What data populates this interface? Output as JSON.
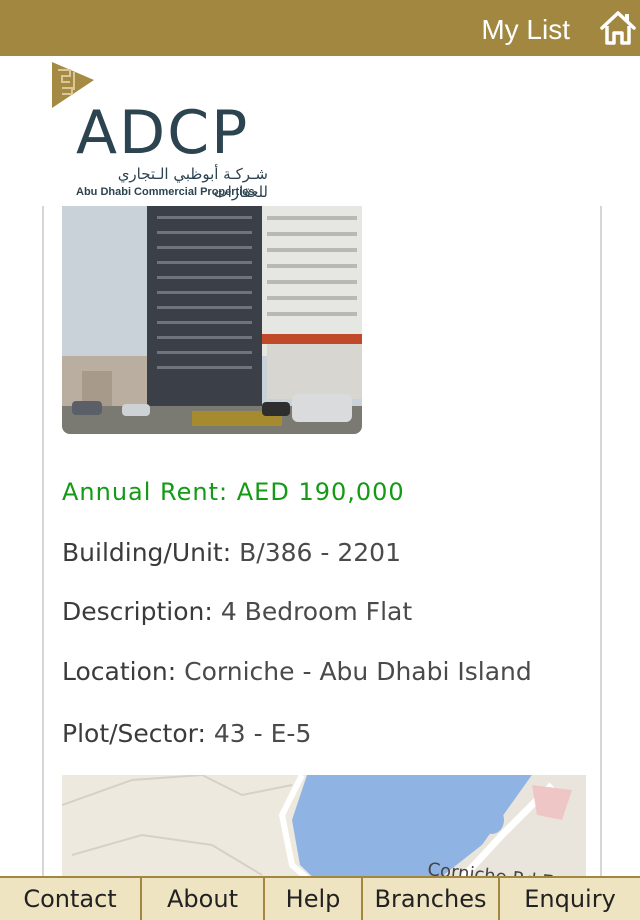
{
  "header": {
    "title": "My List",
    "home_icon": "home-icon"
  },
  "logo": {
    "name": "ADCP",
    "arabic": "شـركـة أبوظبي الـتجاري للعقارات",
    "subtitle": "Abu Dhabi Commercial Properties"
  },
  "listing": {
    "rent": "Annual Rent: AED 190,000",
    "building_label": "Building/Unit:",
    "building_value": "B/386 - 2201",
    "description_label": "Description:",
    "description_value": "4 Bedroom Flat",
    "location_label": "Location:",
    "location_value": "Corniche - Abu Dhabi Island",
    "plot_label": "Plot/Sector:",
    "plot_value": "43 - E-5"
  },
  "map": {
    "road_label": "Corniche Rd E"
  },
  "tabs": [
    "Contact",
    "About",
    "Help",
    "Branches",
    "Enquiry"
  ],
  "colors": {
    "gold": "#a1873f",
    "green": "#149a14",
    "tab_bg": "#efe4c1",
    "brand": "#2c4350"
  }
}
